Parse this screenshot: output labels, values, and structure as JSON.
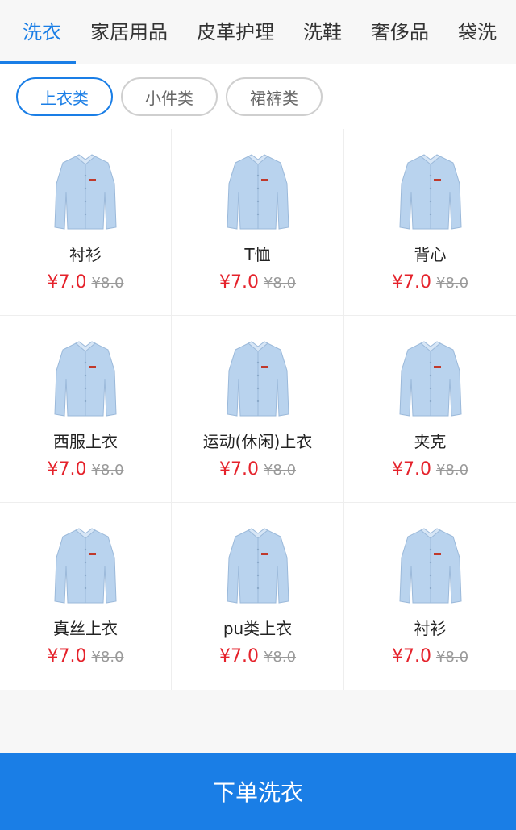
{
  "tabs": [
    {
      "label": "洗衣",
      "active": true
    },
    {
      "label": "家居用品",
      "active": false
    },
    {
      "label": "皮革护理",
      "active": false
    },
    {
      "label": "洗鞋",
      "active": false
    },
    {
      "label": "奢侈品",
      "active": false
    },
    {
      "label": "袋洗",
      "active": false
    }
  ],
  "filters": [
    {
      "label": "上衣类",
      "active": true
    },
    {
      "label": "小件类",
      "active": false
    },
    {
      "label": "裙裤类",
      "active": false
    }
  ],
  "items": [
    {
      "name": "衬衫",
      "price": "¥7.0",
      "old_price": "¥8.0",
      "icon": "shirt-icon"
    },
    {
      "name": "T恤",
      "price": "¥7.0",
      "old_price": "¥8.0",
      "icon": "shirt-icon"
    },
    {
      "name": "背心",
      "price": "¥7.0",
      "old_price": "¥8.0",
      "icon": "shirt-icon"
    },
    {
      "name": "西服上衣",
      "price": "¥7.0",
      "old_price": "¥8.0",
      "icon": "shirt-icon"
    },
    {
      "name": "运动(休闲)上衣",
      "price": "¥7.0",
      "old_price": "¥8.0",
      "icon": "shirt-icon"
    },
    {
      "name": "夹克",
      "price": "¥7.0",
      "old_price": "¥8.0",
      "icon": "shirt-icon"
    },
    {
      "name": "真丝上衣",
      "price": "¥7.0",
      "old_price": "¥8.0",
      "icon": "shirt-icon"
    },
    {
      "name": "pu类上衣",
      "price": "¥7.0",
      "old_price": "¥8.0",
      "icon": "shirt-icon"
    },
    {
      "name": "衬衫",
      "price": "¥7.0",
      "old_price": "¥8.0",
      "icon": "shirt-icon"
    }
  ],
  "order_button": {
    "label": "下单洗衣"
  },
  "colors": {
    "accent": "#1a7ee6",
    "price": "#e5222b",
    "old_price": "#9a9a9a",
    "shirt": "#b9d3ee"
  }
}
